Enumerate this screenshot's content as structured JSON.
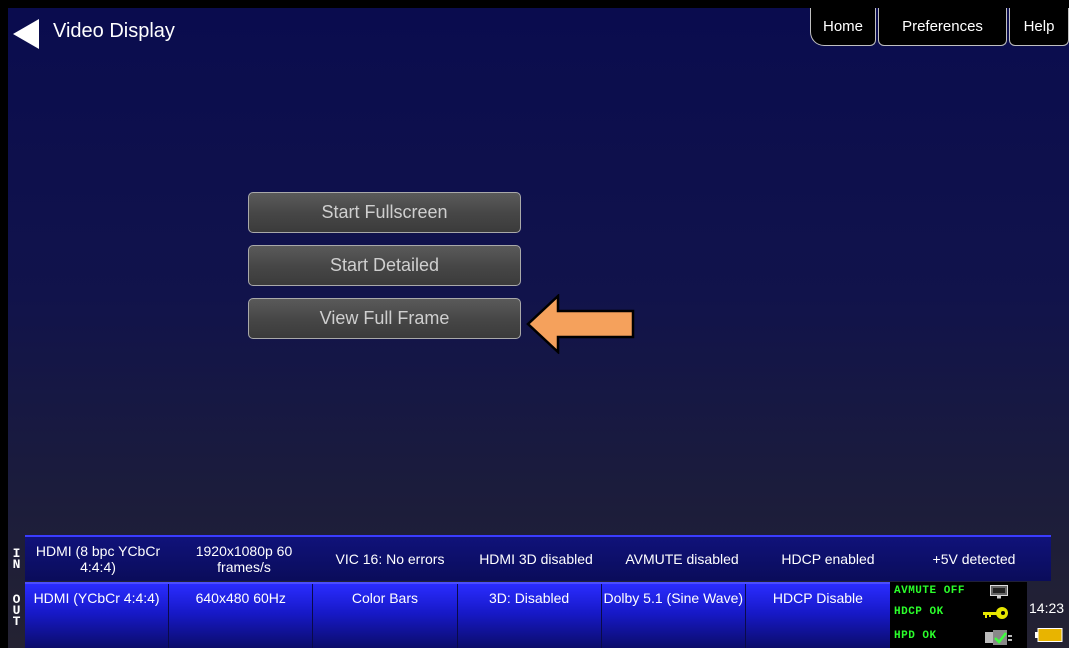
{
  "header": {
    "title": "Video Display",
    "tabs": {
      "home": "Home",
      "preferences": "Preferences",
      "help": "Help"
    }
  },
  "buttons": {
    "start_fullscreen": "Start Fullscreen",
    "start_detailed": "Start Detailed",
    "view_full_frame": "View Full Frame"
  },
  "input_bar": {
    "label": "I\nN",
    "cells": [
      "HDMI (8 bpc YCbCr 4:4:4)",
      "1920x1080p 60 frames/s",
      "VIC 16: No errors",
      "HDMI 3D disabled",
      "AVMUTE disabled",
      "HDCP enabled",
      "+5V detected"
    ]
  },
  "output_bar": {
    "label": "O\nU\nT",
    "cells": [
      "HDMI (YCbCr 4:4:4)",
      "640x480 60Hz",
      "Color Bars",
      "3D: Disabled",
      "Dolby 5.1 (Sine Wave)",
      "HDCP Disable"
    ]
  },
  "status": {
    "avmute": "AVMUTE OFF",
    "hdcp": "HDCP OK",
    "hpd": "HPD OK",
    "time": "14:23"
  },
  "colors": {
    "status_green": "#2bff2b",
    "arrow_orange": "#f5a15c",
    "battery_yellow": "#e8b400"
  },
  "icons": [
    "back-arrow-icon",
    "monitor-icon",
    "key-icon",
    "plug-icon",
    "battery-icon"
  ]
}
